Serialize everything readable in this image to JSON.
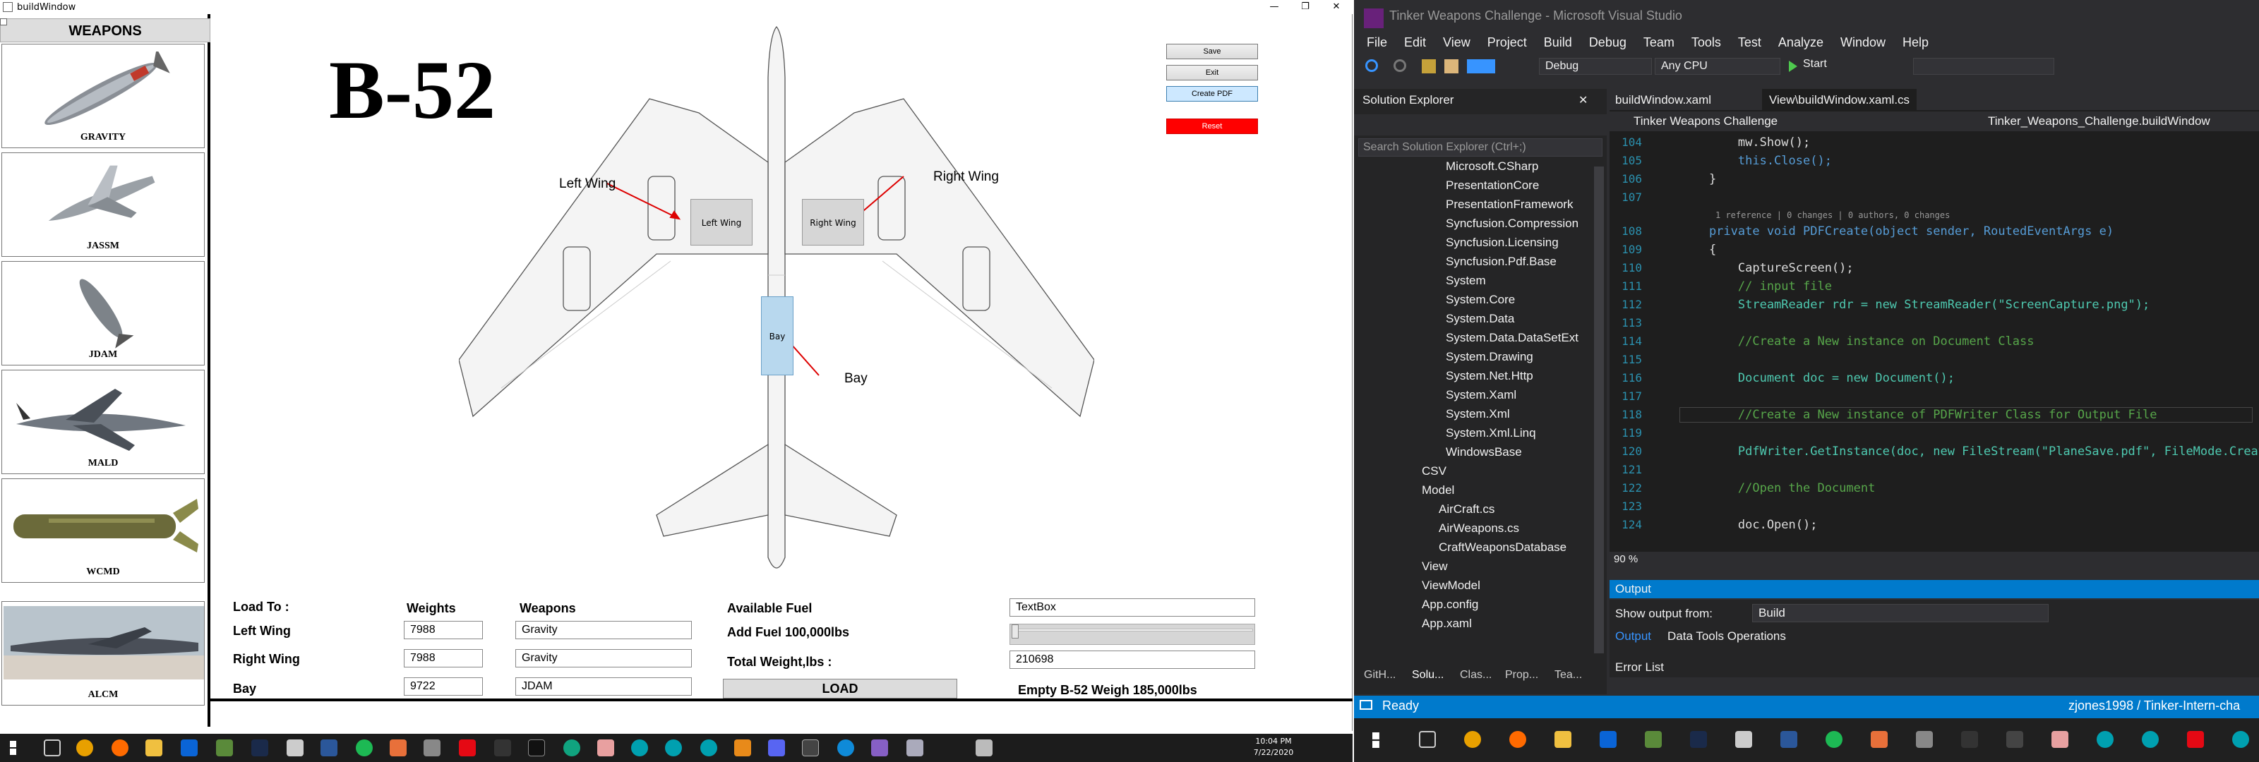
{
  "window": {
    "title": "buildWindow",
    "min": "—",
    "max": "❐",
    "close": "✕"
  },
  "weapons": {
    "heading": "WEAPONS",
    "items": [
      {
        "name": "GRAVITY"
      },
      {
        "name": "JASSM"
      },
      {
        "name": "JDAM"
      },
      {
        "name": "MALD"
      },
      {
        "name": "WCMD"
      },
      {
        "name": "ALCM"
      }
    ]
  },
  "plane": {
    "title": "B-52",
    "left_wing_callout": "Left Wing",
    "right_wing_callout": "Right Wing",
    "bay_callout": "Bay",
    "left_wing_box": "Left Wing",
    "right_wing_box": "Right Wing",
    "bay_box": "Bay"
  },
  "buttons": {
    "save": "Save",
    "exit": "Exit",
    "create_pdf": "Create PDF",
    "reset": "Reset",
    "load": "LOAD"
  },
  "form": {
    "load_to": "Load To :",
    "weights": "Weights",
    "weapons": "Weapons",
    "available_fuel": "Available Fuel",
    "left_wing": "Left Wing",
    "right_wing": "Right Wing",
    "bay": "Bay",
    "left_weight": "7988",
    "right_weight": "7988",
    "bay_weight": "9722",
    "left_weapon": "Gravity",
    "right_weapon": "Gravity",
    "bay_weapon": "JDAM",
    "add_fuel": "Add Fuel 100,000lbs",
    "total_weight": "Total Weight,lbs :",
    "fuel_textbox": "TextBox",
    "total_value": "210698",
    "empty": "Empty B-52 Weigh 185,000lbs"
  },
  "taskbar_left": {
    "time": "10:04 PM",
    "date": "7/22/2020"
  },
  "vs": {
    "title": "Tinker Weapons Challenge - Microsoft Visual Studio",
    "menu": [
      "File",
      "Edit",
      "View",
      "Project",
      "Build",
      "Debug",
      "Team",
      "Tools",
      "Test",
      "Analyze",
      "Window",
      "Help"
    ],
    "config": "Debug",
    "platform": "Any CPU",
    "start": "Start",
    "solution_explorer": "Solution Explorer",
    "search_placeholder": "Search Solution Explorer (Ctrl+;)",
    "tree": [
      "Microsoft.CSharp",
      "PresentationCore",
      "PresentationFramework",
      "Syncfusion.Compression",
      "Syncfusion.Licensing",
      "Syncfusion.Pdf.Base",
      "System",
      "System.Core",
      "System.Data",
      "System.Data.DataSetExt",
      "System.Drawing",
      "System.Net.Http",
      "System.Xaml",
      "System.Xml",
      "System.Xml.Linq",
      "WindowsBase",
      "CSV",
      "Model",
      "AirCraft.cs",
      "AirWeapons.cs",
      "CraftWeaponsDatabase",
      "View",
      "ViewModel",
      "App.config",
      "App.xaml"
    ],
    "tabs": [
      "buildWindow.xaml",
      "View\\buildWindow.xaml.cs"
    ],
    "nav_left": "Tinker Weapons Challenge",
    "nav_right": "Tinker_Weapons_Challenge.buildWindow",
    "lines": [
      "104",
      "105",
      "106",
      "107",
      "108",
      "109",
      "110",
      "111",
      "112",
      "113",
      "114",
      "115",
      "116",
      "117",
      "118",
      "119",
      "120",
      "121",
      "122",
      "123",
      "124"
    ],
    "codelens": "1 reference | 0 changes | 0 authors, 0 changes",
    "code": [
      "        mw.Show();",
      "        this.Close();",
      "    }",
      "",
      "    private void PDFCreate(object sender, RoutedEventArgs e)",
      "    {",
      "        CaptureScreen();",
      "        // input file",
      "        StreamReader rdr = new StreamReader(\"ScreenCapture.png\");",
      "",
      "        //Create a New instance on Document Class",
      "",
      "        Document doc = new Document();",
      "",
      "        //Create a New instance of PDFWriter Class for Output File",
      "",
      "        PdfWriter.GetInstance(doc, new FileStream(\"PlaneSave.pdf\", FileMode.Create));",
      "",
      "        //Open the Document",
      "",
      "        doc.Open();"
    ],
    "zoom": "90 %",
    "output_title": "Output",
    "show_output_from": "Show output from:",
    "output_source": "Build",
    "output_tabs": [
      "Output",
      "Data Tools Operations"
    ],
    "error_list": "Error List",
    "bottom_tabs": [
      "GitH...",
      "Solu...",
      "Clas...",
      "Prop...",
      "Tea..."
    ],
    "status": "Ready",
    "repo": "zjones1998 / Tinker-Intern-cha"
  },
  "colors": {
    "reset": "#ff0000",
    "pdf": "#cde8ff",
    "bay": "#b8d8ee",
    "vs_blue": "#007acc"
  }
}
